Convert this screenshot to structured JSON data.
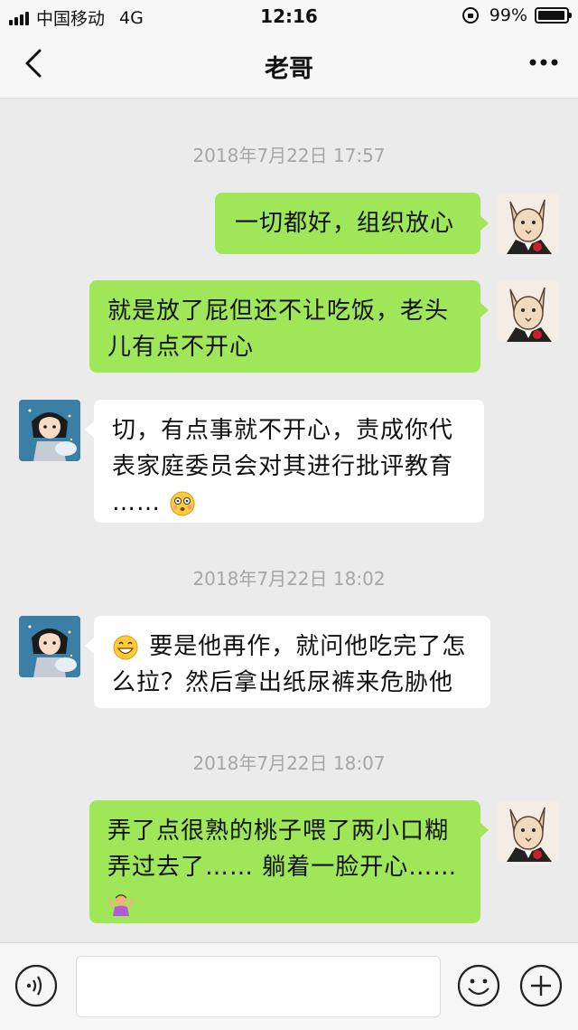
{
  "status_bar": {
    "carrier": "中国移动",
    "network": "4G",
    "time": "12:16",
    "battery": "99%"
  },
  "nav": {
    "title": "老哥"
  },
  "messages": [
    {
      "timestamp": "2018年7月22日 17:57"
    },
    {
      "sender": "me",
      "text": "一切都好，组织放心"
    },
    {
      "sender": "me",
      "text_line1": "就是放了屁但还不让吃饭，老头",
      "text_line2": "儿有点不开心"
    },
    {
      "sender": "other",
      "text_line1": "切，有点事就不开心，责成你代",
      "text_line2": "表家庭委员会对其进行批评教育",
      "text_line3": "……",
      "emoji": "flushed-face-icon"
    },
    {
      "timestamp": "2018年7月22日 18:02"
    },
    {
      "sender": "other",
      "emoji": "grinning-face-icon",
      "text_line1": "要是他再作，就问他吃完了怎",
      "text_line2": "么拉？然后拿出纸尿裤来危胁他"
    },
    {
      "timestamp": "2018年7月22日 18:07"
    },
    {
      "sender": "me",
      "text_line1": "弄了点很熟的桃子喂了两小口糊",
      "text_line2": "弄过去了…… 躺着一脸开心……",
      "emoji": "person-shrugging-icon"
    }
  ],
  "input": {
    "placeholder": ""
  },
  "colors": {
    "sent_bubble": "#9fe658",
    "received_bubble": "#ffffff",
    "background": "#ebebeb",
    "timestamp": "#a6a6a6"
  }
}
